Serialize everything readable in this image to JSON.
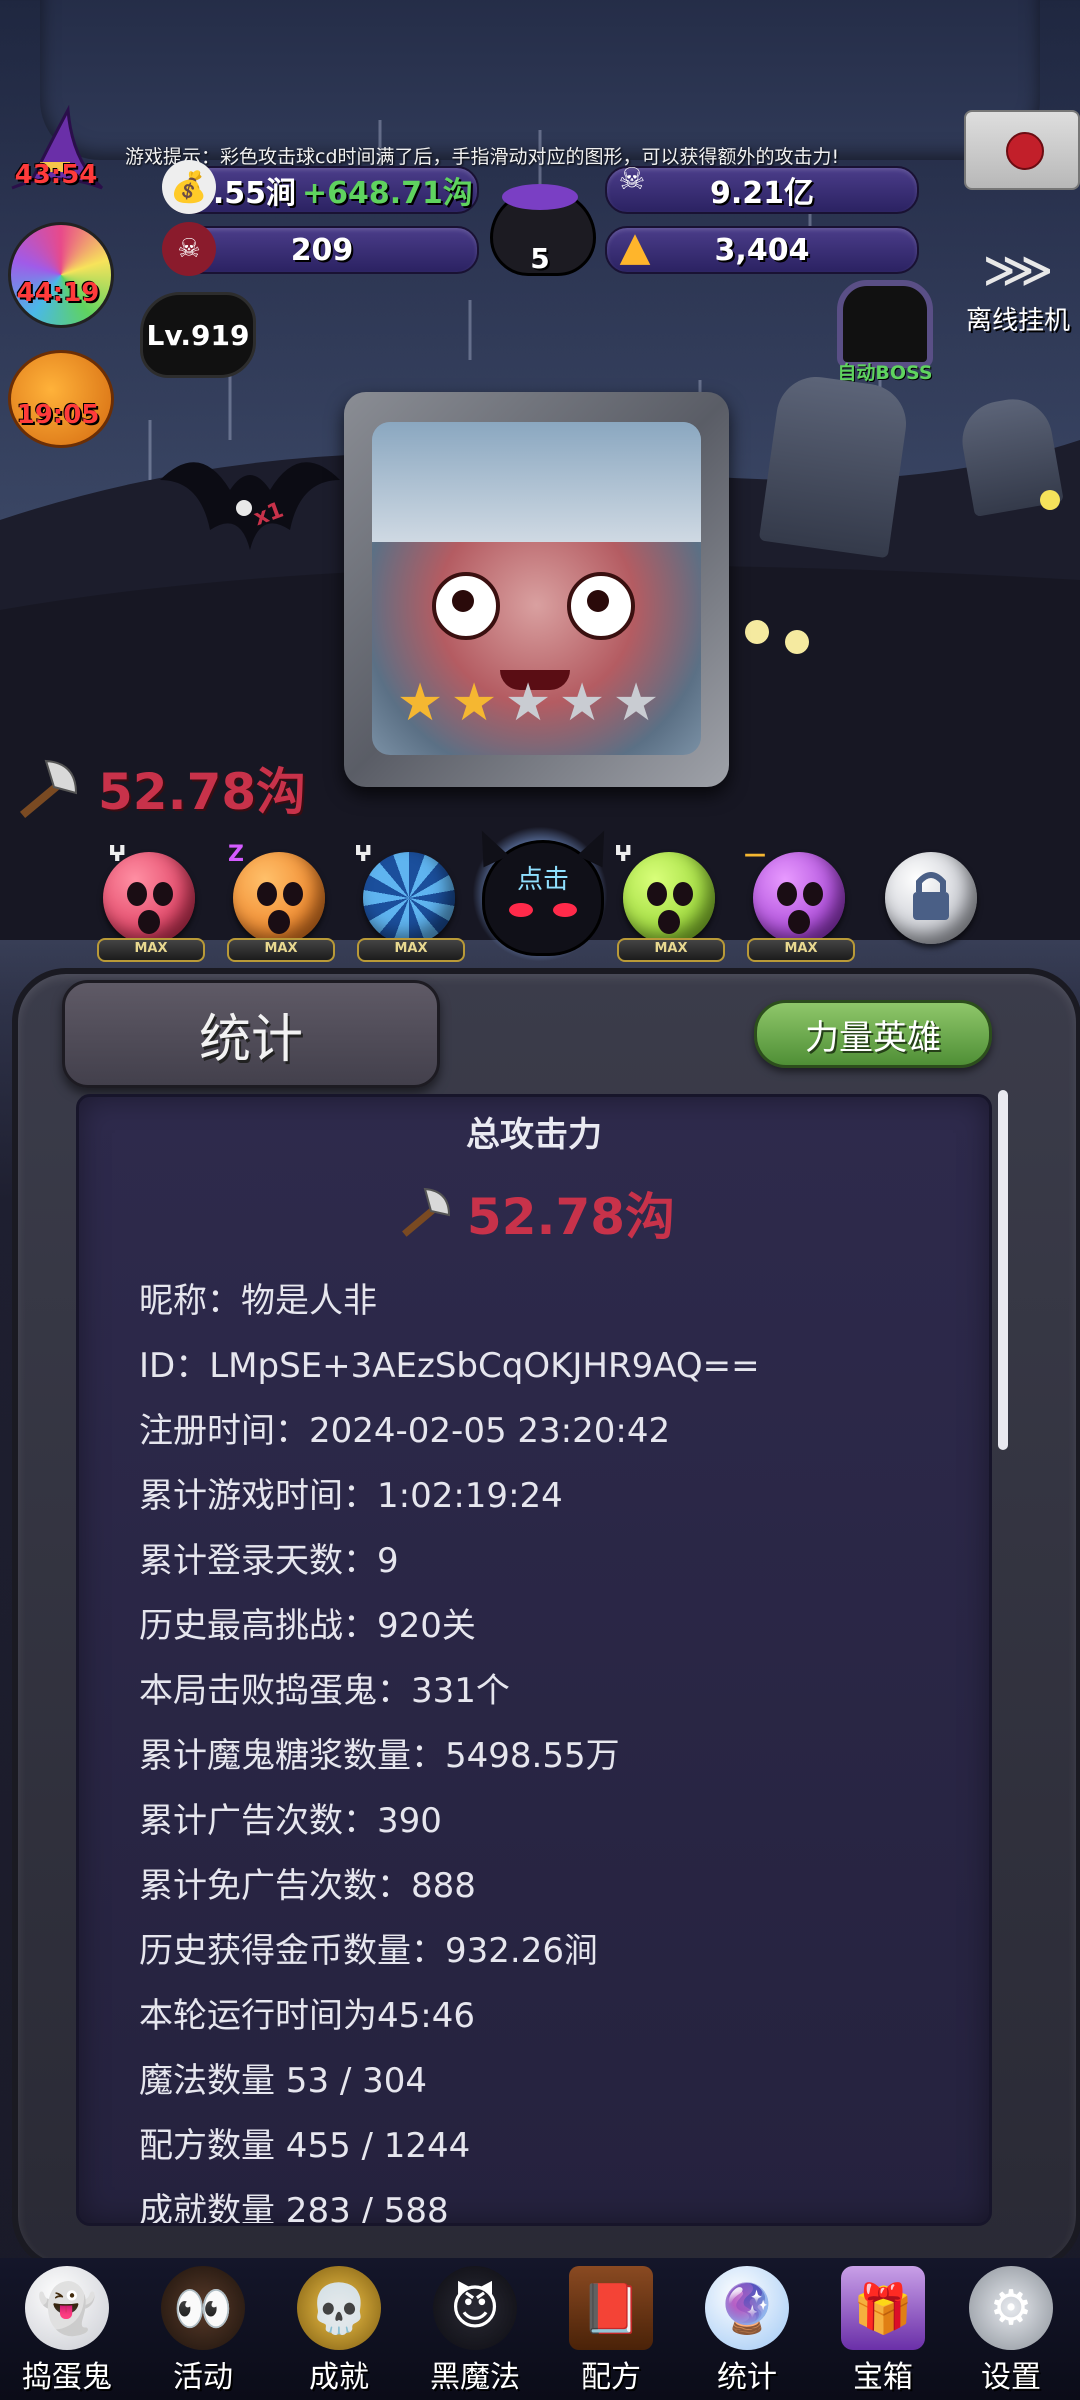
{
  "tip": "游戏提示：彩色攻击球cd时间满了后，手指滑动对应的图形，可以获得额外的攻击力!",
  "resources": {
    "gold": "76.55涧",
    "gold_rate": "+648.71沟",
    "skull_coin": "9.21亿",
    "candy_count": "209",
    "corn_count": "3,404",
    "cauldron_level": "5"
  },
  "timers": {
    "witch": "43:54",
    "lollipop": "44:19",
    "pumpkin": "19:05"
  },
  "level": "Lv.919",
  "offline": "离线挂机",
  "auto_boss": "自动BOSS",
  "bat_multiplier": "x1",
  "dps": "52.78沟",
  "orbs": {
    "marks": [
      "ⵖ",
      "Z",
      "ⵖ",
      "ⵖ",
      "—"
    ],
    "max_label": "MAX",
    "click_label": "点击"
  },
  "panel": {
    "title": "统计",
    "hero_button": "力量英雄",
    "heading": "总攻击力",
    "total": "52.78沟",
    "rows": [
      "昵称：物是人非",
      "ID：LMpSE+3AEzSbCqOKJHR9AQ==",
      "注册时间：2024-02-05 23:20:42",
      "累计游戏时间：1:02:19:24",
      "累计登录天数：9",
      "历史最高挑战：920关",
      "本局击败捣蛋鬼：331个",
      "累计魔鬼糖浆数量：5498.55万",
      "累计广告次数：390",
      "累计免广告次数：888",
      "历史获得金币数量：932.26涧",
      "本轮运行时间为45:46",
      "魔法数量 53 / 304",
      "配方数量 455 / 1244",
      "成就数量 283 / 588"
    ]
  },
  "nav": [
    "捣蛋鬼",
    "活动",
    "成就",
    "黑魔法",
    "配方",
    "统计",
    "宝箱",
    "设置"
  ],
  "colors": {
    "damage": "#c8324a",
    "accent_green": "#5fd35f",
    "panel_bg": "#2e2a4c"
  }
}
